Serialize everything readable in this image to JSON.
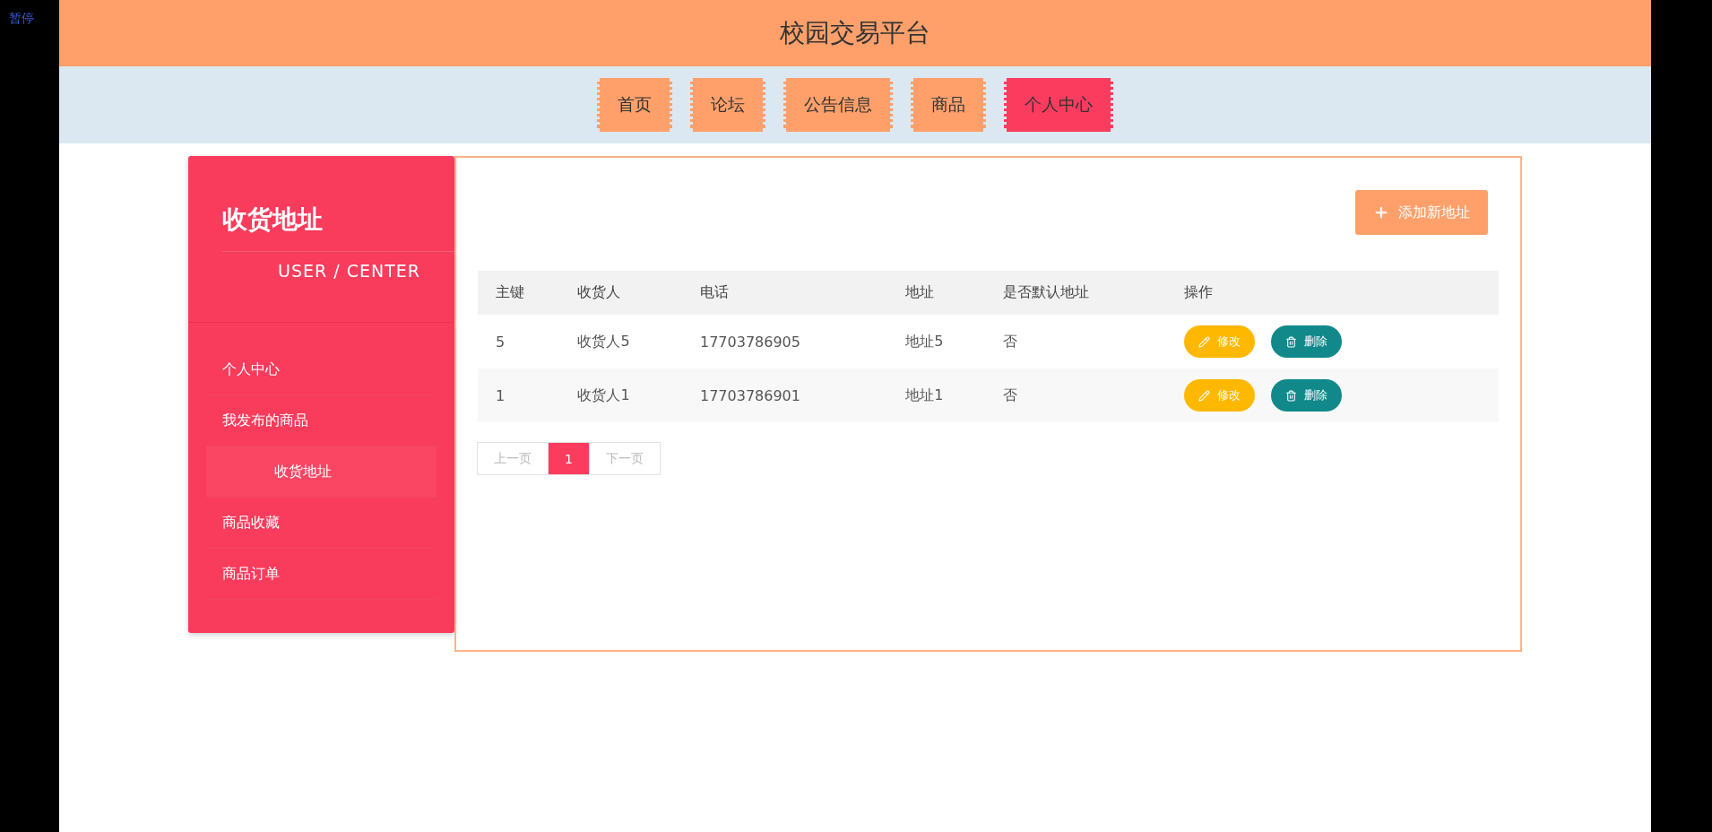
{
  "player": {
    "status": "暂停"
  },
  "header": {
    "title": "校园交易平台"
  },
  "nav": [
    {
      "label": "首页",
      "selected": false
    },
    {
      "label": "论坛",
      "selected": false
    },
    {
      "label": "公告信息",
      "selected": false
    },
    {
      "label": "商品",
      "selected": false
    },
    {
      "label": "个人中心",
      "selected": true
    }
  ],
  "sidebar": {
    "title": "收货地址",
    "subtitle": "USER / CENTER",
    "items": [
      {
        "label": "个人中心",
        "selected": false
      },
      {
        "label": "我发布的商品",
        "selected": false
      },
      {
        "label": "收货地址",
        "selected": true
      },
      {
        "label": "商品收藏",
        "selected": false
      },
      {
        "label": "商品订单",
        "selected": false
      }
    ]
  },
  "add_button": {
    "label": "添加新地址"
  },
  "table": {
    "columns": [
      "主键",
      "收货人",
      "电话",
      "地址",
      "是否默认地址",
      "操作"
    ],
    "rows": [
      {
        "cells": [
          "5",
          "收货人5",
          "17703786905",
          "地址5",
          "否"
        ],
        "actions": [
          "修改",
          "删除"
        ]
      },
      {
        "cells": [
          "1",
          "收货人1",
          "17703786901",
          "地址1",
          "否"
        ],
        "actions": [
          "修改",
          "删除"
        ]
      }
    ]
  },
  "pagination": {
    "prev": "上一页",
    "pages": [
      {
        "label": "1",
        "selected": true
      }
    ],
    "next": "下一页"
  }
}
